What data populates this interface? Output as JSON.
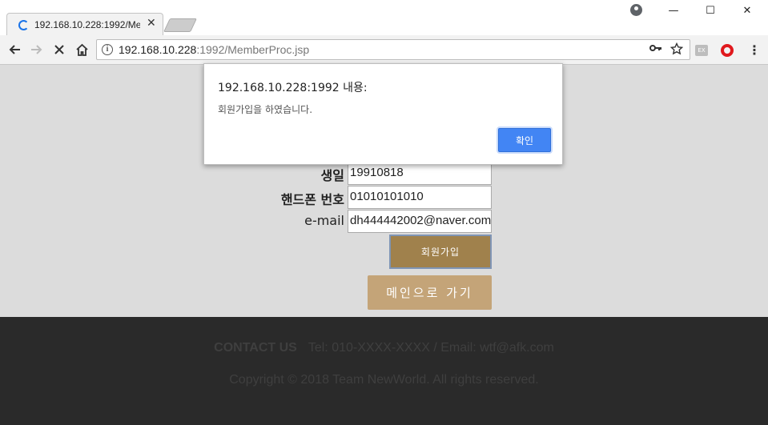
{
  "browser": {
    "tab_title": "192.168.10.228:1992/Mem",
    "tab_close": "✕",
    "url_host": "192.168.10.228",
    "url_rest": ":1992/MemberProc.jsp",
    "icons": {
      "back": "back-arrow-icon",
      "forward": "forward-arrow-icon",
      "stop": "stop-icon",
      "home": "home-icon",
      "info": "info-icon",
      "key": "key-icon",
      "star": "star-icon",
      "menu": "menu-icon"
    },
    "extension_label": "EX",
    "window_controls": {
      "minimize": "—",
      "maximize": "☐",
      "close": "✕"
    }
  },
  "dialog": {
    "title": "192.168.10.228:1992 내용:",
    "message": "회원가입을 하였습니다.",
    "ok_label": "확인"
  },
  "form": {
    "rows": [
      {
        "label": "생일",
        "value": "19910818"
      },
      {
        "label": "핸드폰 번호",
        "value": "01010101010"
      },
      {
        "label": "e-mail",
        "value": "dh444442002@naver.com"
      }
    ],
    "signup_label": "회원가입",
    "main_label": "메인으로 가기"
  },
  "footer": {
    "contact_label": "CONTACT US",
    "contact_text": "Tel: 010-XXXX-XXXX / Email: wtf@afk.com",
    "copyright": "Copyright © 2018 Team NewWorld. All rights reserved."
  },
  "colors": {
    "accent_blue": "#4285f4",
    "signup_button": "#a0814c",
    "main_button": "#c4a478",
    "footer_bg": "#2a2a2a",
    "page_bg": "#dcdcdc"
  }
}
